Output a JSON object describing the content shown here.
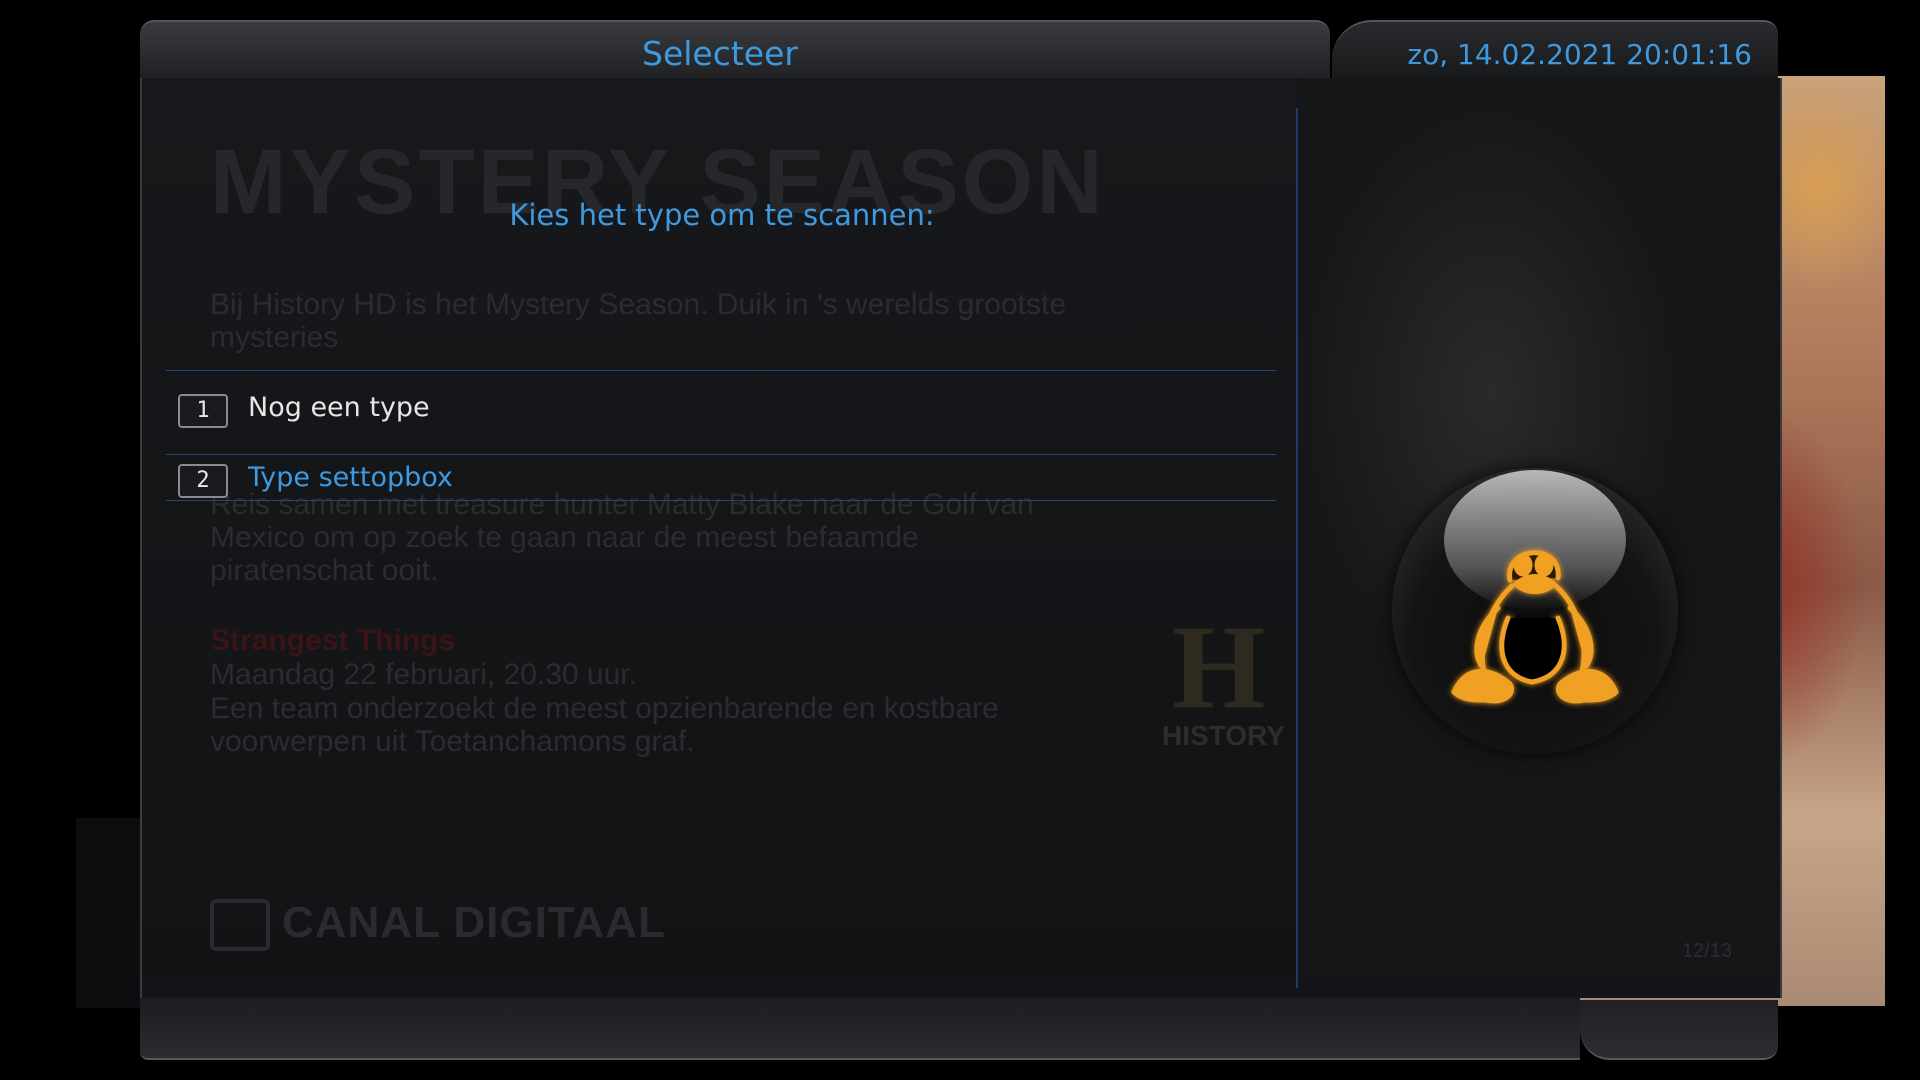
{
  "window": {
    "title": "Selecteer",
    "datetime": "zo, 14.02.2021  20:01:16"
  },
  "dialog": {
    "prompt": "Kies het type om te scannen:",
    "items": [
      {
        "number": "1",
        "label": "Nog een type",
        "selected": false
      },
      {
        "number": "2",
        "label": "Type settopbox",
        "selected": true
      }
    ]
  },
  "background": {
    "headline": "MYSTERY SEASON",
    "intro": "Bij History HD is het Mystery Season. Duik in 's werelds grootste mysteries",
    "entry1_text": "Reis samen met treasure hunter Matty Blake naar de Golf van Mexico om op zoek te gaan naar de meest befaamde piratenschat ooit.",
    "entry2_title": "Strangest Things",
    "entry2_date": "Maandag 22 februari, 20.30 uur.",
    "entry2_text": "Een team onderzoekt de meest opzienbarende en kostbare voorwerpen uit Toetanchamons graf.",
    "channel_logo": "HISTORY",
    "provider_logo": "CANAL DIGITAAL",
    "page_counter": "12/13"
  },
  "colors": {
    "accent": "#3d9ae0",
    "separator": "#24447a",
    "tux_glow": "#f0a020"
  },
  "icons": {
    "emblem": "tux-penguin-icon"
  }
}
